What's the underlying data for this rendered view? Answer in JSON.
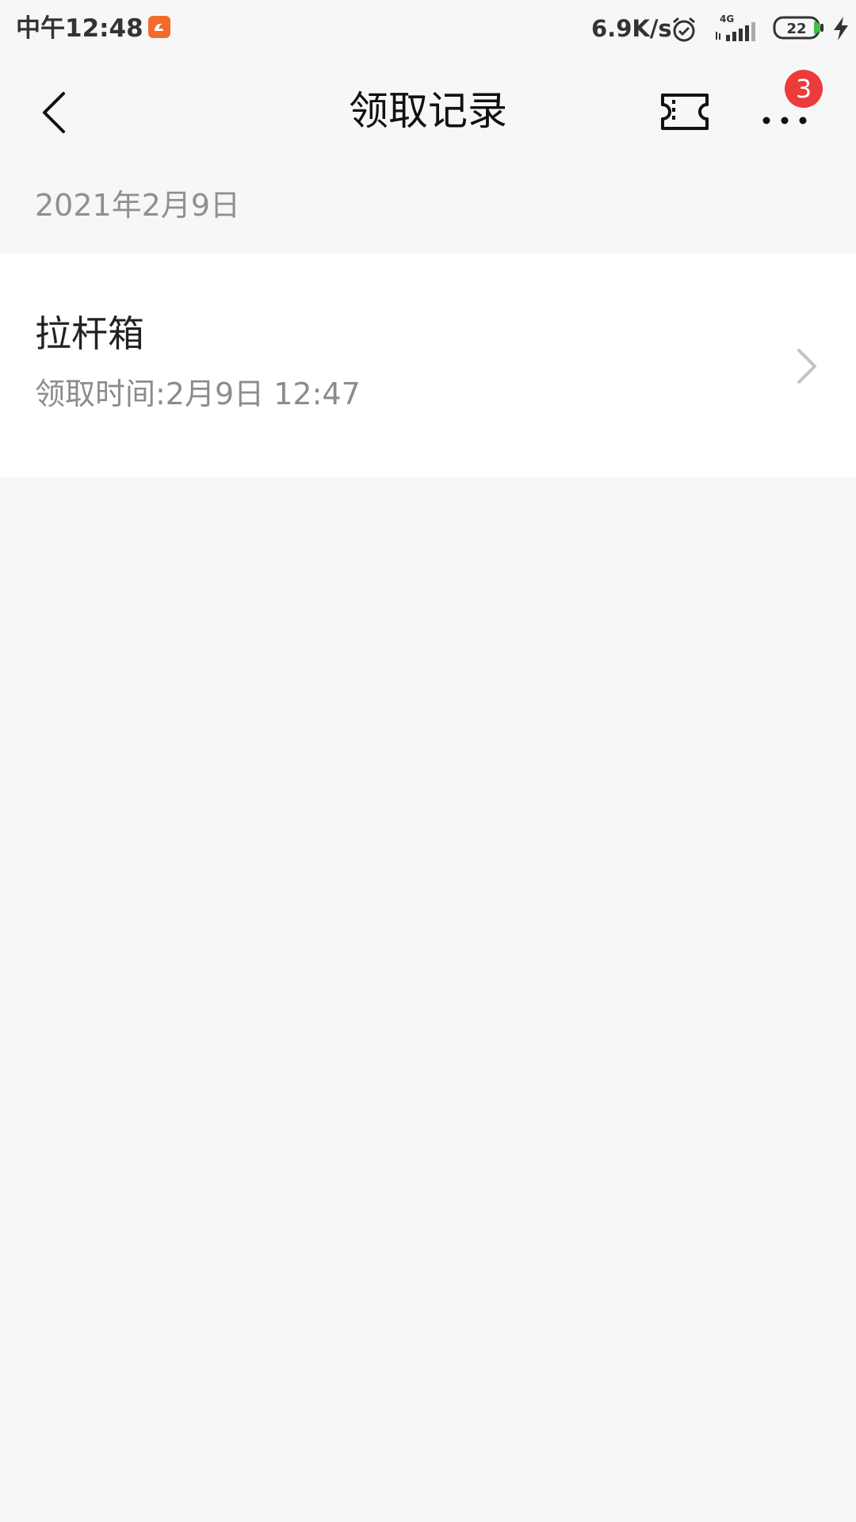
{
  "status_bar": {
    "time": "中午12:48",
    "net_speed": "6.9K/s",
    "network_type": "4G",
    "battery_level": "22",
    "icons": [
      "uc-browser-icon",
      "alarm-icon",
      "signal-icon",
      "battery-icon",
      "charging-icon"
    ]
  },
  "header": {
    "title": "领取记录",
    "back_icon": "chevron-left-icon",
    "ticket_icon": "ticket-icon",
    "more_icon": "more-dots-icon",
    "badge_count": "3"
  },
  "records": {
    "date": "2021年2月9日",
    "items": [
      {
        "name": "拉杆箱",
        "time": "领取时间:2月9日 12:47"
      }
    ]
  },
  "colors": {
    "background": "#f7f7f7",
    "card": "#ffffff",
    "badge": "#eb3b3b",
    "uc_brand": "#f26b2b",
    "secondary_text": "#8c8c8c"
  }
}
